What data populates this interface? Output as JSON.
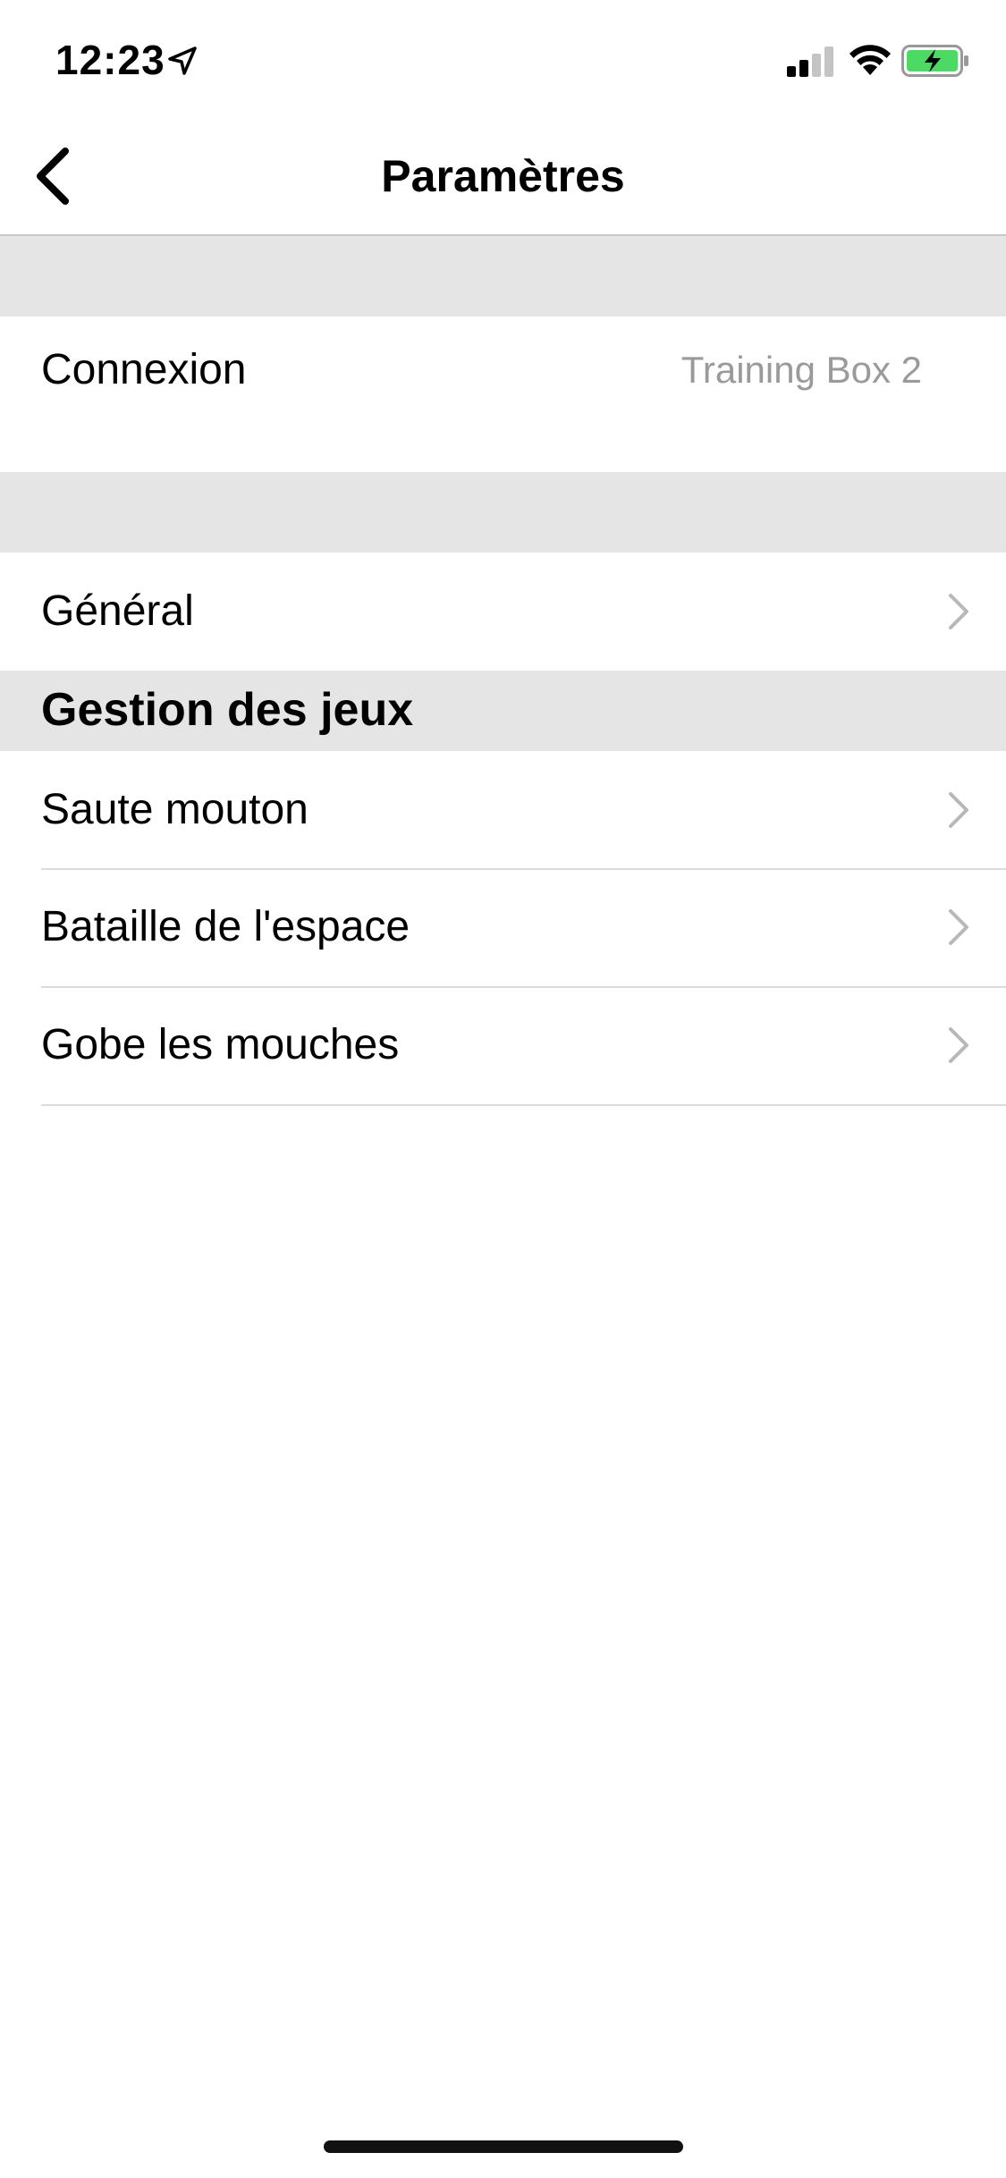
{
  "status_bar": {
    "time": "12:23",
    "location_icon": "location-arrow-icon",
    "signal_icon": "cellular-signal-icon",
    "wifi_icon": "wifi-icon",
    "battery_icon": "battery-charging-icon",
    "battery_color": "#4cd964"
  },
  "nav": {
    "back_icon": "chevron-left-icon",
    "title": "Paramètres"
  },
  "connection": {
    "label": "Connexion",
    "value": "Training Box 2"
  },
  "general": {
    "label": "Général"
  },
  "games_section": {
    "header": "Gestion des jeux",
    "items": [
      {
        "label": "Saute mouton"
      },
      {
        "label": "Bataille de l'espace"
      },
      {
        "label": "Gobe les mouches"
      }
    ]
  },
  "colors": {
    "section_background": "#e5e5e5",
    "secondary_text": "#9a9a9a",
    "chevron": "#b8b8b8"
  }
}
